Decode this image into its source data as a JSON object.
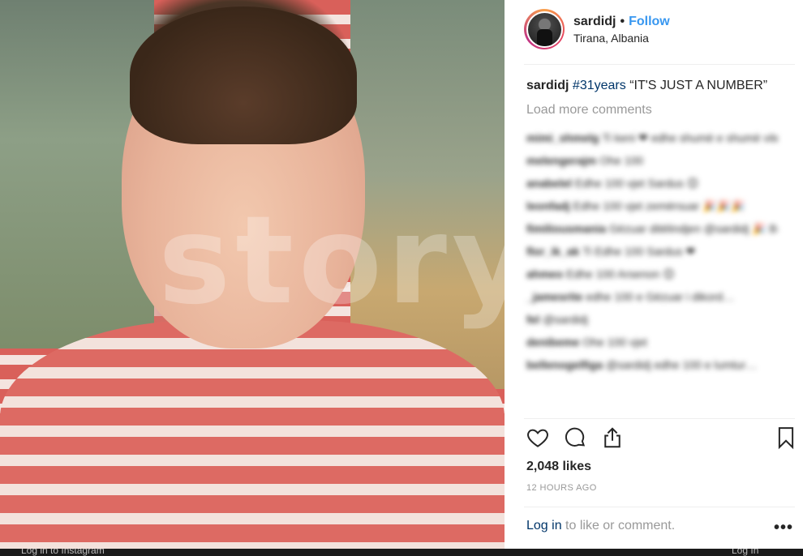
{
  "post": {
    "username": "sardidj",
    "follow_label": "Follow",
    "separator": "•",
    "location": "Tirana, Albania",
    "watermark": "story.al",
    "caption": {
      "username": "sardidj",
      "hashtag": "#31years",
      "text": "“IT'S JUST A NUMBER”"
    },
    "load_more_label": "Load more comments",
    "comments": [
      {
        "user": "mimi_shmelg",
        "text": "Ti keni ❤ edhe shumë e shumë vite të lumtura @sardidj 😊 Jetën i përkryer gjith jeton ✨🌿💋"
      },
      {
        "user": "melengerajm",
        "text": "Ohe 100"
      },
      {
        "user": "anabelel",
        "text": "Edhe 100 vjet Sardus 😊"
      },
      {
        "user": "leonfadj",
        "text": "Edhe 100 vjet zemërsuar 🎉🎉🎉"
      },
      {
        "user": "fimiliousmania",
        "text": "Gëzuar ditëlindjen @sardidj 🎉 Bon sard 💋"
      },
      {
        "user": "flor_ik_ak",
        "text": "Ti Edhe 100 Sardus ❤"
      },
      {
        "user": "ahmeo",
        "text": "Edhe 100 Arsenon 😊"
      },
      {
        "user": "_jamesrite",
        "text": "edhe 100 e Gëzuar i dikord…"
      },
      {
        "user": "fel",
        "text": "@sardidj"
      },
      {
        "user": "denibeme",
        "text": "Ohe 100 vjet"
      },
      {
        "user": "bellenogelfiga",
        "text": "@sardidj edhe 100 e lumtur…"
      }
    ],
    "likes_label": "2,048 likes",
    "time_label": "12 HOURS AGO",
    "login_link": "Log in",
    "login_suffix": " to like or comment.",
    "more_label": "•••"
  },
  "icons": {
    "like": "heart-icon",
    "comment": "comment-icon",
    "share": "share-icon",
    "save": "bookmark-icon",
    "more": "more-options-icon"
  },
  "bottom_bar": {
    "left_text": "Log in to Instagram",
    "right_text": "Log In"
  }
}
